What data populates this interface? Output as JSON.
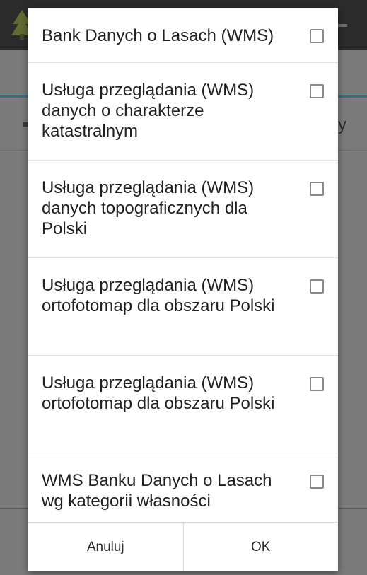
{
  "dialog": {
    "options": [
      {
        "label": "Bank Danych o Lasach (WMS)",
        "checked": false
      },
      {
        "label": "Usługa przeglądania (WMS) danych o charakterze katastralnym",
        "checked": false
      },
      {
        "label": "Usługa przeglądania (WMS) danych topograficznych dla Polski",
        "checked": false
      },
      {
        "label": "Usługa przeglądania (WMS) ortofotomap dla obszaru Polski",
        "checked": false
      },
      {
        "label": "Usługa przeglądania (WMS) ortofotomap dla obszaru Polski",
        "checked": false
      },
      {
        "label": "WMS Banku Danych o Lasach wg kategorii własności",
        "checked": false
      }
    ],
    "cancel_label": "Anuluj",
    "ok_label": "OK"
  },
  "background": {
    "partial_text": "y"
  },
  "colors": {
    "toolbar": "#2b2b2b",
    "accent_line": "#2e6f8e",
    "dialog_bg": "#ffffff",
    "checkbox_border": "#8a8a8a"
  }
}
